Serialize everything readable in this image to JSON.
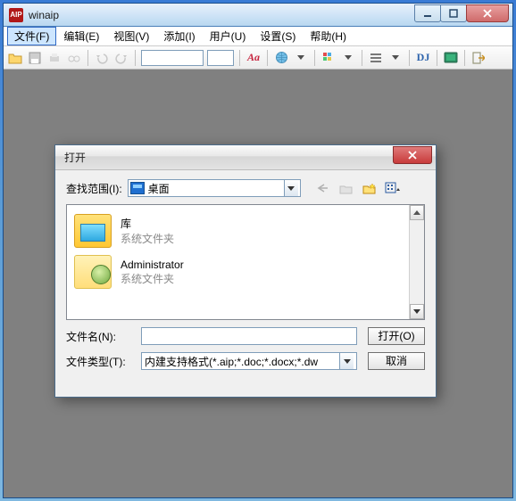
{
  "window": {
    "title": "winaip",
    "app_icon_text": "AIP"
  },
  "menu": {
    "items": [
      {
        "label": "文件(F)",
        "active": true
      },
      {
        "label": "编辑(E)"
      },
      {
        "label": "视图(V)"
      },
      {
        "label": "添加(I)"
      },
      {
        "label": "用户(U)"
      },
      {
        "label": "设置(S)"
      },
      {
        "label": "帮助(H)"
      }
    ]
  },
  "toolbar": {
    "font_style_label": "Aa",
    "dj_label": "DJ"
  },
  "dialog": {
    "title": "打开",
    "look_label": "查找范围(I):",
    "look_value": "桌面",
    "entries": [
      {
        "name": "库",
        "sub": "系统文件夹",
        "icon": "folder-lib"
      },
      {
        "name": "Administrator",
        "sub": "系统文件夹",
        "icon": "folder-user"
      }
    ],
    "filename_label": "文件名(N):",
    "filename_value": "",
    "filetype_label": "文件类型(T):",
    "filetype_value": "内建支持格式(*.aip;*.doc;*.docx;*.dw",
    "open_btn": "打开(O)",
    "cancel_btn": "取消"
  }
}
